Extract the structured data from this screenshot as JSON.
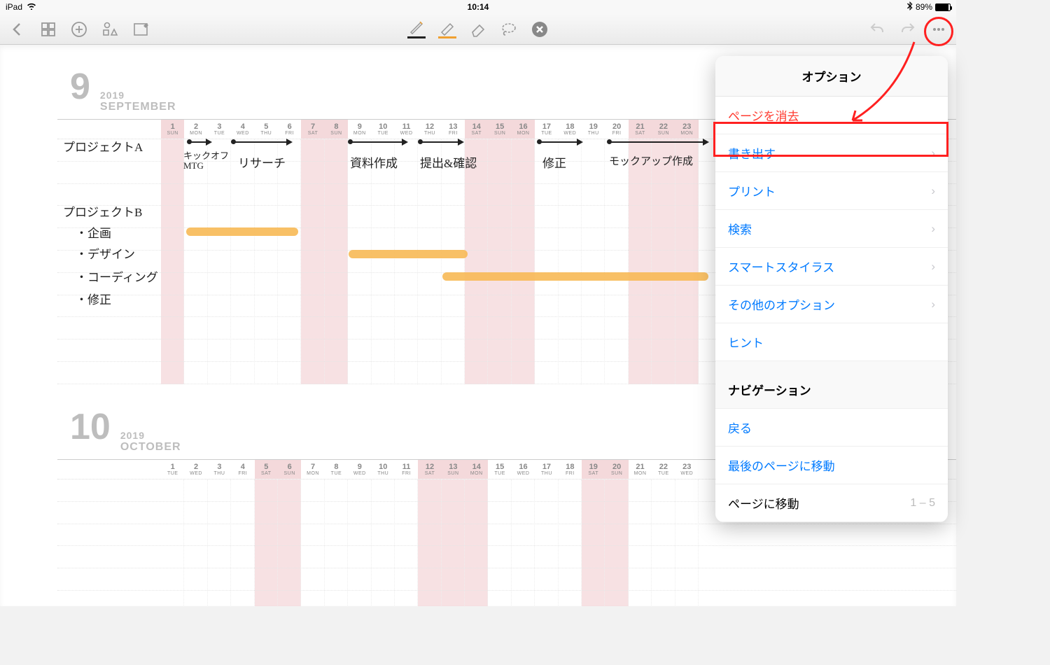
{
  "status": {
    "device": "iPad",
    "time": "10:14",
    "battery": "89%"
  },
  "months": [
    {
      "num": "9",
      "year": "2019",
      "name": "SEPTEMBER",
      "days": [
        {
          "n": "1",
          "d": "SUN",
          "w": true
        },
        {
          "n": "2",
          "d": "MON"
        },
        {
          "n": "3",
          "d": "TUE"
        },
        {
          "n": "4",
          "d": "WED"
        },
        {
          "n": "5",
          "d": "THU"
        },
        {
          "n": "6",
          "d": "FRI"
        },
        {
          "n": "7",
          "d": "SAT",
          "w": true
        },
        {
          "n": "8",
          "d": "SUN",
          "w": true
        },
        {
          "n": "9",
          "d": "MON"
        },
        {
          "n": "10",
          "d": "TUE"
        },
        {
          "n": "11",
          "d": "WED"
        },
        {
          "n": "12",
          "d": "THU"
        },
        {
          "n": "13",
          "d": "FRI"
        },
        {
          "n": "14",
          "d": "SAT",
          "w": true
        },
        {
          "n": "15",
          "d": "SUN",
          "w": true
        },
        {
          "n": "16",
          "d": "MON",
          "w": true
        },
        {
          "n": "17",
          "d": "TUE"
        },
        {
          "n": "18",
          "d": "WED"
        },
        {
          "n": "19",
          "d": "THU"
        },
        {
          "n": "20",
          "d": "FRI"
        },
        {
          "n": "21",
          "d": "SAT",
          "w": true
        },
        {
          "n": "22",
          "d": "SUN",
          "w": true
        },
        {
          "n": "23",
          "d": "MON",
          "w": true
        }
      ]
    },
    {
      "num": "10",
      "year": "2019",
      "name": "OCTOBER",
      "days": [
        {
          "n": "1",
          "d": "TUE"
        },
        {
          "n": "2",
          "d": "WED"
        },
        {
          "n": "3",
          "d": "THU"
        },
        {
          "n": "4",
          "d": "FRI"
        },
        {
          "n": "5",
          "d": "SAT",
          "w": true
        },
        {
          "n": "6",
          "d": "SUN",
          "w": true
        },
        {
          "n": "7",
          "d": "MON"
        },
        {
          "n": "8",
          "d": "TUE"
        },
        {
          "n": "9",
          "d": "WED"
        },
        {
          "n": "10",
          "d": "THU"
        },
        {
          "n": "11",
          "d": "FRI"
        },
        {
          "n": "12",
          "d": "SAT",
          "w": true
        },
        {
          "n": "13",
          "d": "SUN",
          "w": true
        },
        {
          "n": "14",
          "d": "MON",
          "w": true
        },
        {
          "n": "15",
          "d": "TUE"
        },
        {
          "n": "16",
          "d": "WED"
        },
        {
          "n": "17",
          "d": "THU"
        },
        {
          "n": "18",
          "d": "FRI"
        },
        {
          "n": "19",
          "d": "SAT",
          "w": true
        },
        {
          "n": "20",
          "d": "SUN",
          "w": true
        },
        {
          "n": "21",
          "d": "MON"
        },
        {
          "n": "22",
          "d": "TUE"
        },
        {
          "n": "23",
          "d": "WED"
        }
      ]
    }
  ],
  "notes": {
    "projA": "プロジェクトA",
    "projB": "プロジェクトB",
    "taskA1": "キックオフ\nMTG",
    "taskA2": "リサーチ",
    "taskA3": "資料作成",
    "taskA4": "提出&確認",
    "taskA5": "修正",
    "taskA6": "モックアップ作成",
    "b1": "・企画",
    "b2": "・デザイン",
    "b3": "・コーディング",
    "b4": "・修正"
  },
  "popover": {
    "title": "オプション",
    "items": [
      {
        "label": "ページを消去",
        "type": "danger"
      },
      {
        "label": "書き出す",
        "type": "link",
        "chev": true,
        "highlight": true
      },
      {
        "label": "プリント",
        "type": "link",
        "chev": true
      },
      {
        "label": "検索",
        "type": "link",
        "chev": true
      },
      {
        "label": "スマートスタイラス",
        "type": "link",
        "chev": true
      },
      {
        "label": "その他のオプション",
        "type": "link",
        "chev": true
      },
      {
        "label": "ヒント",
        "type": "link"
      }
    ],
    "nav_title": "ナビゲーション",
    "nav": [
      {
        "label": "戻る",
        "type": "link"
      },
      {
        "label": "最後のページに移動",
        "type": "link"
      },
      {
        "label": "ページに移動",
        "type": "plain",
        "range": "1 – 5"
      }
    ]
  }
}
